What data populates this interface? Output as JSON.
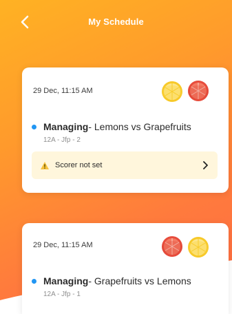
{
  "header": {
    "title": "My Schedule",
    "back_icon": "chevron-left-icon"
  },
  "colors": {
    "gradient_start": "#ffb223",
    "gradient_end": "#ff6a45",
    "dot": "#2196f3",
    "alert_bg": "#fff6dc"
  },
  "schedule": [
    {
      "date": "29 Dec, 11:15 AM",
      "fruit_icons": [
        "lemon-icon",
        "grapefruit-icon"
      ],
      "role": "Managing",
      "matchup": " - Lemons vs Grapefruits",
      "details": "12A - Jfp - 2",
      "alert": {
        "icon": "warning-icon",
        "text": "Scorer not set",
        "chevron": "chevron-right-icon"
      }
    },
    {
      "date": "29 Dec, 11:15 AM",
      "fruit_icons": [
        "grapefruit-icon",
        "lemon-icon"
      ],
      "role": "Managing",
      "matchup": " - Grapefruits vs Lemons",
      "details": "12A - Jfp - 1"
    }
  ]
}
